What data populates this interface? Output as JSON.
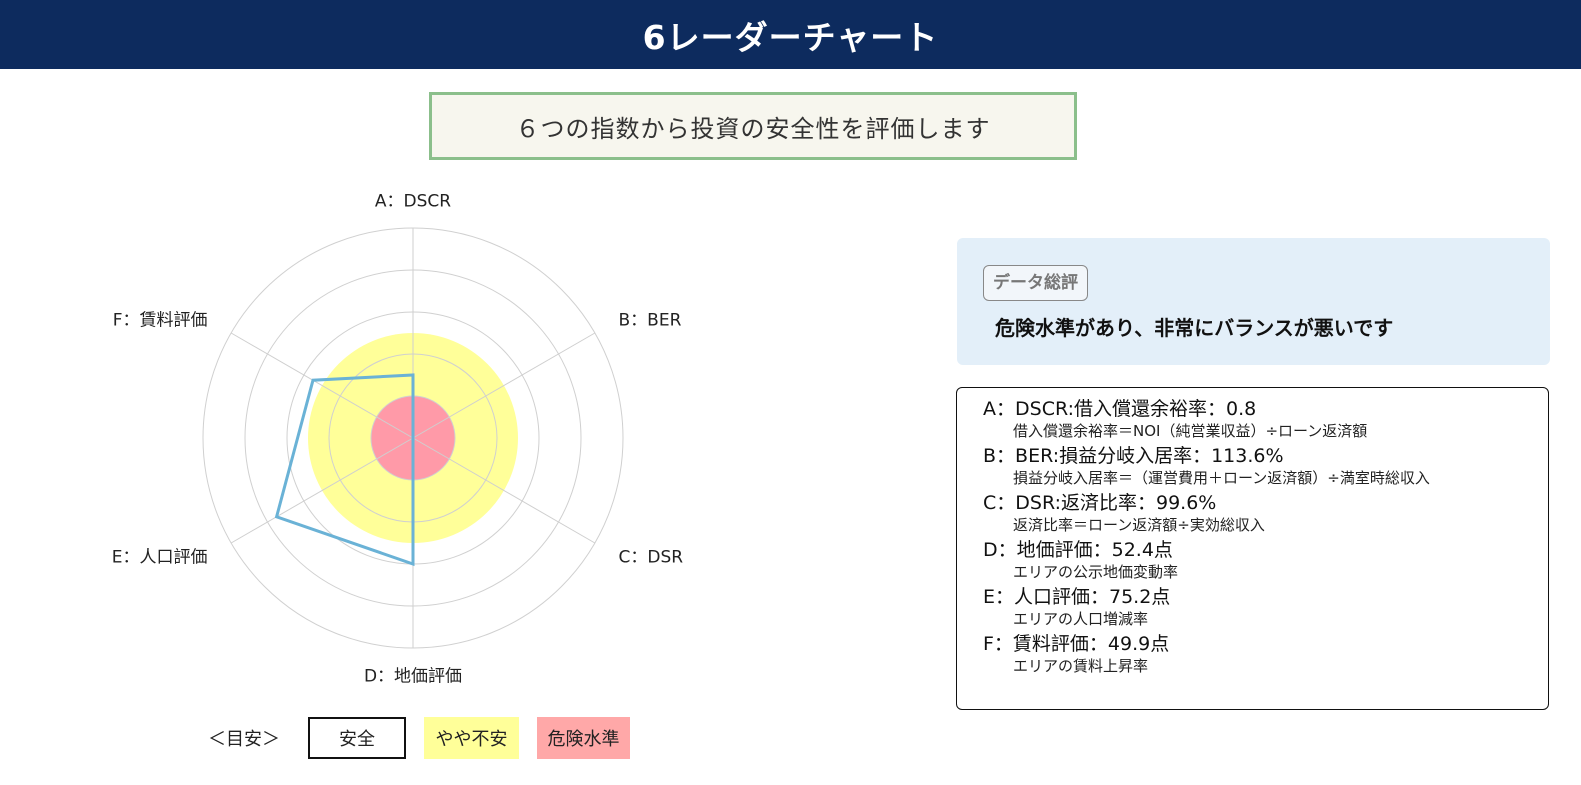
{
  "header": {
    "title": "6レーダーチャート"
  },
  "subtitle": "６つの指数から投資の安全性を評価します",
  "chart_data": {
    "type": "radar",
    "axes": [
      "A：DSCR",
      "B：BER",
      "C：DSR",
      "D：地価評価",
      "E：人口評価",
      "F：賃料評価"
    ],
    "rlim": [
      0,
      100
    ],
    "rings": [
      20,
      40,
      60,
      80,
      100
    ],
    "series": [
      {
        "values": [
          30,
          0,
          0,
          60,
          75,
          55
        ],
        "color": "#6ab2d6"
      }
    ],
    "zones": [
      {
        "label": "危険水準",
        "to": 20,
        "color": "#ff9aa8"
      },
      {
        "label": "やや不安",
        "to": 50,
        "color": "#ffff99"
      }
    ]
  },
  "legend": {
    "title": "＜目安＞",
    "items": [
      {
        "label": "安全",
        "color": "#ffffff"
      },
      {
        "label": "やや不安",
        "color": "#ffff99"
      },
      {
        "label": "危険水準",
        "color": "#ffa8a8"
      }
    ]
  },
  "summary": {
    "badge": "データ総評",
    "text": "危険水準があり、非常にバランスが悪いです"
  },
  "metrics": [
    {
      "title": "A：DSCR:借入償還余裕率：0.8",
      "desc": "借入償還余裕率＝NOI（純営業収益）÷ローン返済額"
    },
    {
      "title": "B：BER:損益分岐入居率：113.6%",
      "desc": "損益分岐入居率＝（運営費用＋ローン返済額）÷満室時総収入"
    },
    {
      "title": "C：DSR:返済比率：99.6%",
      "desc": "返済比率＝ローン返済額÷実効総収入"
    },
    {
      "title": "D：地価評価：52.4点",
      "desc": "エリアの公示地価変動率"
    },
    {
      "title": "E：人口評価：75.2点",
      "desc": "エリアの人口増減率"
    },
    {
      "title": "F：賃料評価：49.9点",
      "desc": "エリアの賃料上昇率"
    }
  ]
}
